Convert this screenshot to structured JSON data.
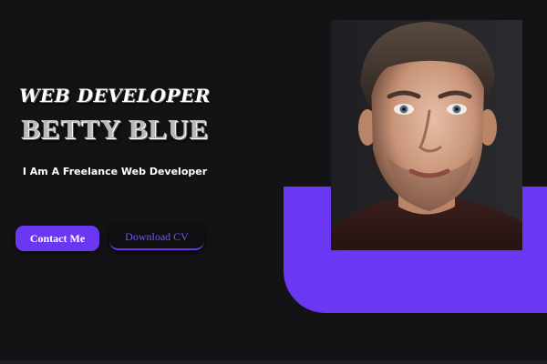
{
  "hero": {
    "role": "WEB DEVELOPER",
    "name": "BETTY BLUE",
    "tagline": "I Am A Freelance Web Developer"
  },
  "buttons": {
    "contact_label": "Contact Me",
    "download_label": "Download CV"
  },
  "colors": {
    "background": "#131316",
    "accent": "#6a38f3",
    "accent_text": "#7c52f5",
    "text": "#ffffff"
  }
}
